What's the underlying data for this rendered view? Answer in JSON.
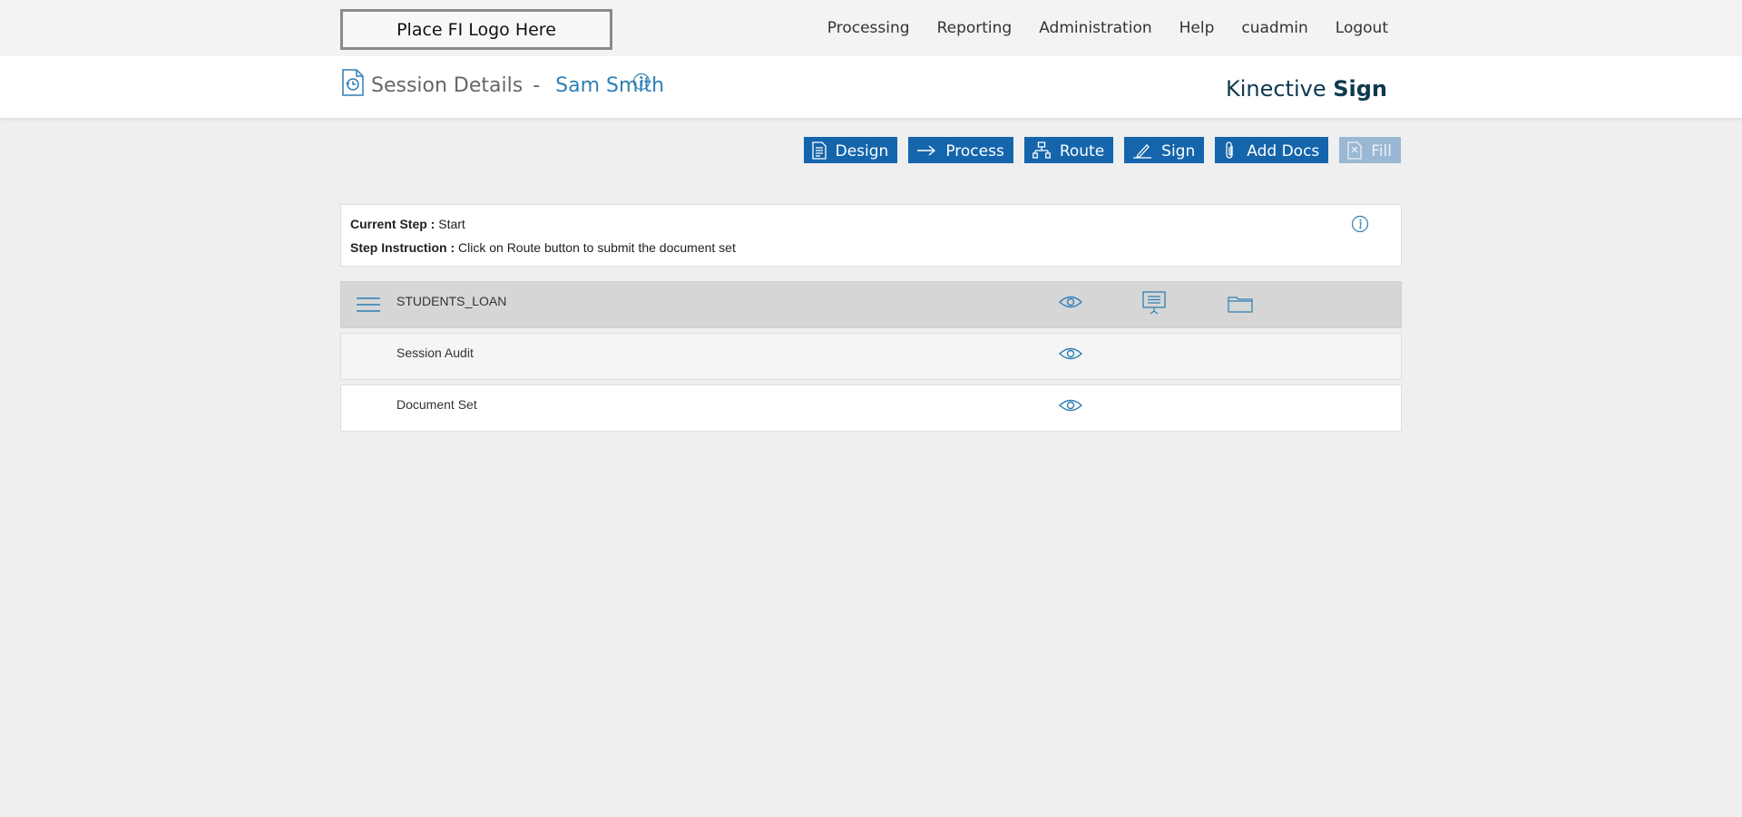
{
  "logo_text": "Place FI Logo Here",
  "nav": {
    "items": [
      "Processing",
      "Reporting",
      "Administration",
      "Help",
      "cuadmin",
      "Logout"
    ]
  },
  "header": {
    "title": "Session Details",
    "separator": "-",
    "customer_name": "Sam Smith",
    "brand_regular": "Kinective",
    "brand_bold": "Sign"
  },
  "actions": {
    "design": "Design",
    "process": "Process",
    "route": "Route",
    "sign": "Sign",
    "add_docs": "Add Docs",
    "fill": "Fill"
  },
  "step": {
    "current_label": "Current Step :",
    "current_value": "Start",
    "instruction_label": "Step Instruction :",
    "instruction_value": "Click on Route button to submit the document set"
  },
  "documents": [
    {
      "label": "STUDENTS_LOAN"
    },
    {
      "label": "Session Audit"
    },
    {
      "label": "Document Set"
    }
  ],
  "colors": {
    "primary": "#1465ac",
    "link": "#2f7fb5",
    "disabled": "#9ab8d3",
    "brand": "#0e3a4f"
  }
}
